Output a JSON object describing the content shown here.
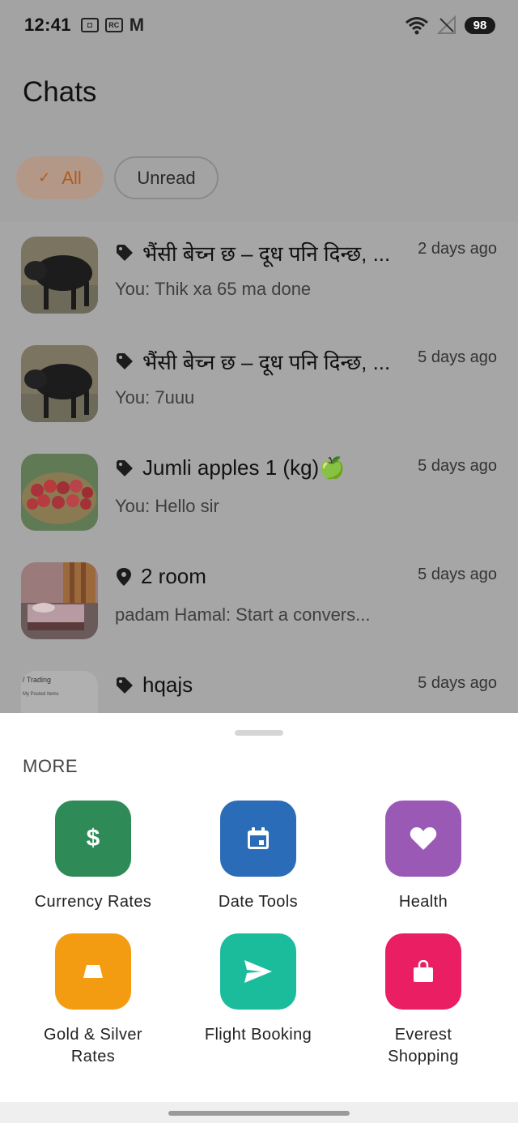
{
  "status_bar": {
    "time": "12:41",
    "icons": [
      "screenshot-icon",
      "rc-icon",
      "gmail-icon"
    ],
    "right_icons": [
      "wifi-icon",
      "no-signal-icon"
    ],
    "battery": "98"
  },
  "header": {
    "title": "Chats",
    "filters": [
      {
        "label": "All",
        "selected": true
      },
      {
        "label": "Unread",
        "selected": false
      }
    ]
  },
  "chats": [
    {
      "icon": "tag-icon",
      "title": "भैंसी बेच्न छ – दूध पनि दिन्छ, ...",
      "time": "2 days ago",
      "preview": "You: Thik xa 65 ma done",
      "thumb": "buffalo"
    },
    {
      "icon": "tag-icon",
      "title": "भैंसी बेच्न छ – दूध पनि दिन्छ, ...",
      "time": "5 days ago",
      "preview": "You: 7uuu",
      "thumb": "buffalo"
    },
    {
      "icon": "tag-icon",
      "title": "Jumli apples 1 (kg)🍏",
      "time": "5 days ago",
      "preview": "You: Hello sir",
      "thumb": "apples"
    },
    {
      "icon": "location-pin-icon",
      "title": "2 room",
      "time": "5 days ago",
      "preview": "padam Hamal: Start a convers...",
      "thumb": "room"
    },
    {
      "icon": "tag-icon",
      "title": "hqajs",
      "time": "5 days ago",
      "preview": "",
      "thumb": "screenshot",
      "thumb_text": [
        "/ Trading",
        "My Posted Items"
      ]
    }
  ],
  "sheet": {
    "title": "MORE",
    "tiles": [
      {
        "label": "Currency Rates",
        "icon": "dollar-icon",
        "color": "#2e8b57"
      },
      {
        "label": "Date Tools",
        "icon": "calendar-icon",
        "color": "#2b6cb8"
      },
      {
        "label": "Health",
        "icon": "heart-icon",
        "color": "#9b59b6"
      },
      {
        "label": "Gold & Silver\nRates",
        "icon": "gold-bar-icon",
        "color": "#f39c12"
      },
      {
        "label": "Flight Booking",
        "icon": "send-icon",
        "color": "#1abc9c"
      },
      {
        "label": "Everest\nShopping",
        "icon": "shopping-bag-icon",
        "color": "#e91e63"
      }
    ]
  }
}
